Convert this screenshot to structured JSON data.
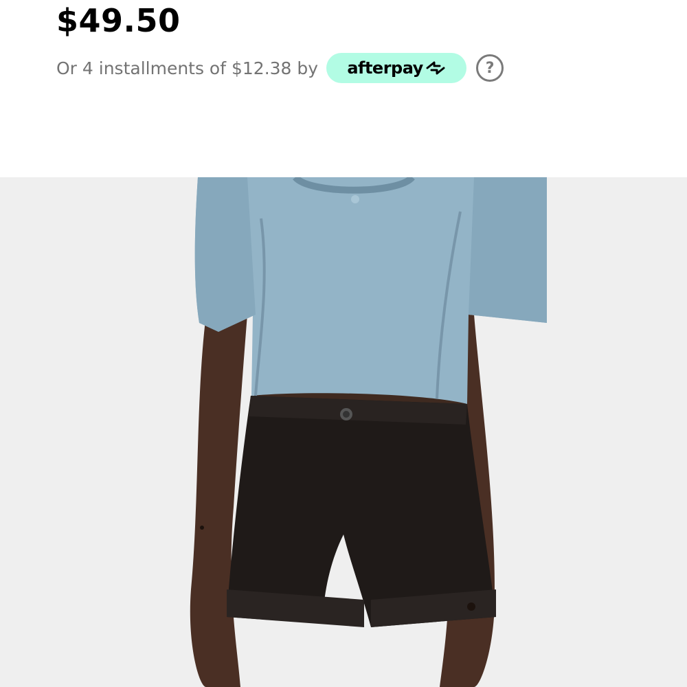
{
  "product": {
    "price": "$49.50",
    "installments_text": "Or 4 installments of $12.38 by",
    "afterpay_label": "afterpay",
    "help_label": "?"
  },
  "image": {
    "description_icon": "product-photo"
  },
  "colors": {
    "afterpay_bg": "#b2fce4",
    "text_muted": "#737373",
    "price": "#000000",
    "photo_bg": "#efefef"
  }
}
